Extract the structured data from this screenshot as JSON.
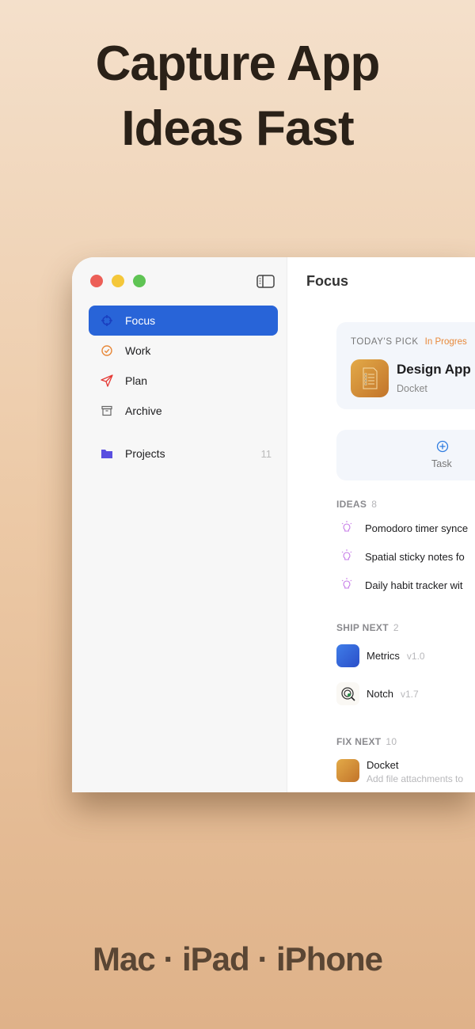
{
  "headline": {
    "line1": "Capture App",
    "line2": "Ideas Fast"
  },
  "footer": "Mac · iPad · iPhone",
  "sidebar": {
    "items": [
      {
        "label": "Focus",
        "icon": "crosshair-icon"
      },
      {
        "label": "Work",
        "icon": "check-circle-icon"
      },
      {
        "label": "Plan",
        "icon": "paper-plane-icon"
      },
      {
        "label": "Archive",
        "icon": "archive-box-icon"
      }
    ],
    "projects": {
      "label": "Projects",
      "count": "11"
    }
  },
  "main": {
    "title": "Focus",
    "pick": {
      "label": "TODAY'S PICK",
      "status": "In Progres",
      "title": "Design App",
      "subtitle": "Docket"
    },
    "add_task": "Task",
    "ideas": {
      "label": "IDEAS",
      "count": "8",
      "items": [
        "Pomodoro timer synce",
        "Spatial sticky notes fo",
        "Daily habit tracker wit"
      ]
    },
    "ship_next": {
      "label": "SHIP NEXT",
      "count": "2",
      "items": [
        {
          "name": "Metrics",
          "version": "v1.0"
        },
        {
          "name": "Notch",
          "version": "v1.7"
        }
      ]
    },
    "fix_next": {
      "label": "FIX NEXT",
      "count": "10",
      "items": [
        {
          "name": "Docket",
          "detail": "Add file attachments to"
        }
      ]
    }
  },
  "colors": {
    "accent": "#2864d8",
    "status": "#e8893a",
    "idea": "#c77ce8"
  }
}
